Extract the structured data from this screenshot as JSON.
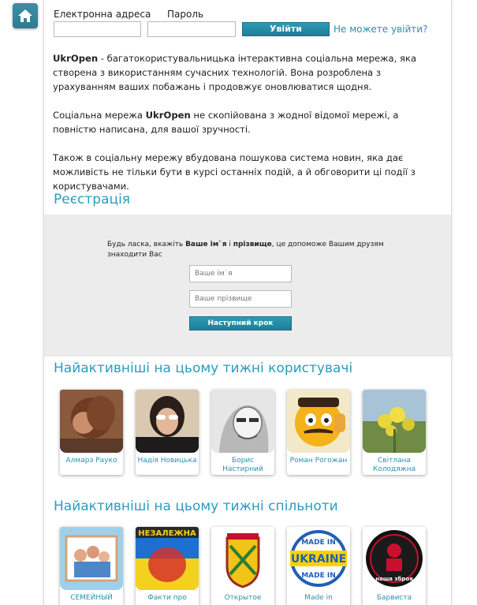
{
  "header": {
    "home_icon": "home-icon"
  },
  "login": {
    "email_label": "Електронна адреса",
    "password_label": "Пароль",
    "email_value": "",
    "password_value": "",
    "submit_label": "Увійти",
    "forgot_label": "Не можете увійти?"
  },
  "intro": {
    "p1_brand": "UkrOpen",
    "p1_text": " - багатокористувальницька інтерактивна соціальна мережа, яка створена з використанням сучасних технологій. Вона розроблена з урахуванням ваших побажань і продовжує оновлюватися щодня.",
    "p2_before": "Соціальна мережа ",
    "p2_brand": "UkrOpen",
    "p2_after": " не скопійована з жодної відомої мережі, а повністю написана, для вашої зручності.",
    "p3_text": "Також в соціальну мережу вбудована пошукова система новин, яка дає можливість не тільки бути в курсі останніх подій, а й обговорити ці події з користувачами."
  },
  "registration": {
    "title": "Реєстрація",
    "hint_before": "Будь ласка, вкажіть ",
    "hint_bold1": "Ваше ім`я",
    "hint_mid": " і ",
    "hint_bold2": "прізвище",
    "hint_after": ", це допоможе Вашим друзям знаходити Вас",
    "first_name_placeholder": "Ваше ім`я",
    "last_name_placeholder": "Ваше прізвище",
    "next_label": "Наступний крок"
  },
  "active_users": {
    "title": "Найактивніші на цьому тижні користувачі",
    "items": [
      {
        "name": "Алмарэ Рауко"
      },
      {
        "name": "Надія Новицька"
      },
      {
        "name": "Борис Настирний"
      },
      {
        "name": "Роман Рогожан"
      },
      {
        "name": "Світлана Колодяжна"
      }
    ]
  },
  "active_communities": {
    "title": "Найактивніші на цьому тижні спільноти",
    "items": [
      {
        "name": "СЕМЕЙНЫЙ"
      },
      {
        "name": "Факти про"
      },
      {
        "name": "Открытое"
      },
      {
        "name": "Made in"
      },
      {
        "name": "Барвиста"
      }
    ],
    "image_texts": {
      "nezalezhna": "НЕЗАЛЕЖНА",
      "made_in_ukraine_top": "MADE IN",
      "made_in_ukraine_main": "UKRAINE",
      "made_in_ukraine_bottom": "MADE IN",
      "nasha_zbroya": "наша зброя"
    }
  },
  "colors": {
    "accent": "#2a9cbd",
    "link": "#2c8fb0",
    "button": "#1e7f98",
    "reg_bg": "#ececec"
  }
}
